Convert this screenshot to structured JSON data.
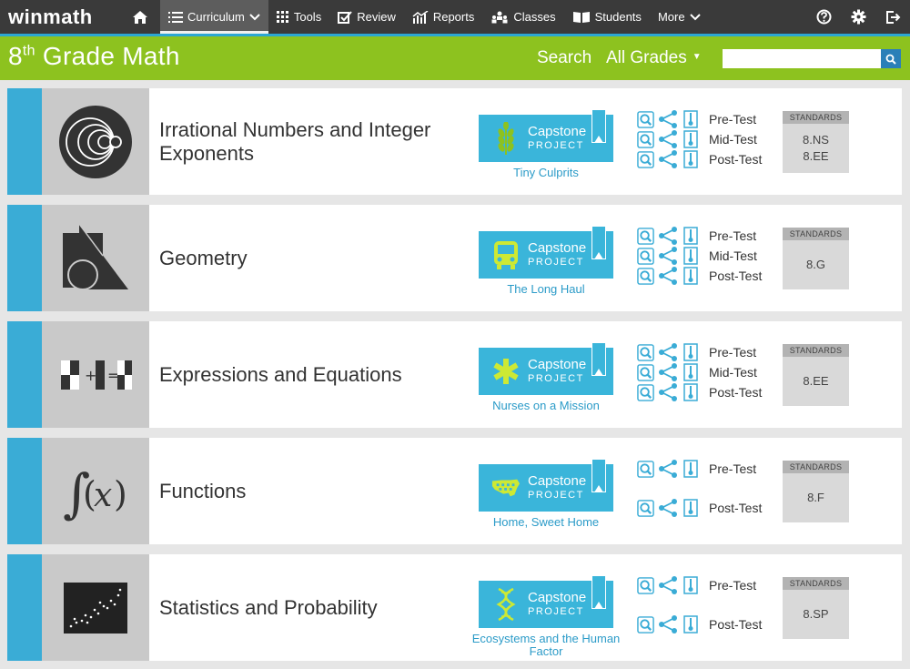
{
  "nav": {
    "logo": "winmath",
    "items": [
      {
        "key": "curriculum",
        "label": "Curriculum",
        "icon": "list-icon",
        "active": true
      },
      {
        "key": "tools",
        "label": "Tools",
        "icon": "grid-icon"
      },
      {
        "key": "review",
        "label": "Review",
        "icon": "checkbox-icon"
      },
      {
        "key": "reports",
        "label": "Reports",
        "icon": "chart-icon"
      },
      {
        "key": "classes",
        "label": "Classes",
        "icon": "group-icon"
      },
      {
        "key": "students",
        "label": "Students",
        "icon": "book-icon"
      },
      {
        "key": "more",
        "label": "More",
        "icon": "chevron-down-icon"
      }
    ]
  },
  "header": {
    "title_num": "8",
    "title_sup": "th",
    "title_rest": " Grade Math",
    "search_label": "Search",
    "grade_select": "All Grades",
    "search_placeholder": ""
  },
  "test_labels": {
    "pre": "Pre-Test",
    "mid": "Mid-Test",
    "post": "Post-Test"
  },
  "capstone": {
    "word": "Capstone",
    "project": "PROJECT"
  },
  "standards_label": "STANDARDS",
  "units": [
    {
      "title": "Irrational Numbers and Integer Exponents",
      "thumb": "nested-circles-icon",
      "capstone_icon": "wheat-icon",
      "capstone_name": "Tiny Culprits",
      "tests": [
        "pre",
        "mid",
        "post"
      ],
      "standards": [
        "8.NS",
        "8.EE"
      ]
    },
    {
      "title": "Geometry",
      "thumb": "shapes-icon",
      "capstone_icon": "bus-icon",
      "capstone_name": "The Long Haul",
      "tests": [
        "pre",
        "mid",
        "post"
      ],
      "standards": [
        "8.G"
      ]
    },
    {
      "title": "Expressions and Equations",
      "thumb": "equation-icon",
      "capstone_icon": "medical-star-icon",
      "capstone_name": "Nurses on a Mission",
      "tests": [
        "pre",
        "mid",
        "post"
      ],
      "standards": [
        "8.EE"
      ]
    },
    {
      "title": "Functions",
      "thumb": "integral-icon",
      "capstone_icon": "usa-map-icon",
      "capstone_name": "Home, Sweet Home",
      "tests": [
        "pre",
        "post"
      ],
      "standards": [
        "8.F"
      ]
    },
    {
      "title": "Statistics and Probability",
      "thumb": "scatter-plot-icon",
      "capstone_icon": "dna-icon",
      "capstone_name": "Ecosystems and the Human Factor",
      "tests": [
        "pre",
        "post"
      ],
      "standards": [
        "8.SP"
      ]
    }
  ]
}
